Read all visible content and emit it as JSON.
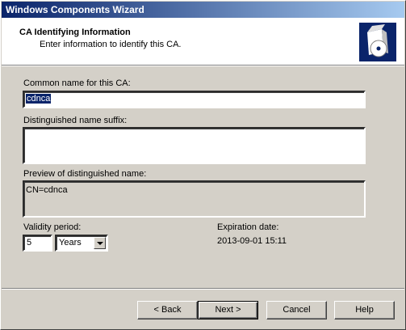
{
  "window": {
    "title": "Windows Components Wizard"
  },
  "header": {
    "title": "CA Identifying Information",
    "subtitle": "Enter information to identify this CA."
  },
  "form": {
    "common_name_label": "Common name for this CA:",
    "common_name_value": "cdnca",
    "dn_suffix_label": "Distinguished name suffix:",
    "dn_suffix_value": "",
    "preview_label": "Preview of distinguished name:",
    "preview_value": "CN=cdnca",
    "validity_label": "Validity period:",
    "validity_value": "5",
    "validity_unit": "Years",
    "expiration_label": "Expiration date:",
    "expiration_value": "2013-09-01 15:11"
  },
  "buttons": {
    "back": "< Back",
    "next": "Next >",
    "cancel": "Cancel",
    "help": "Help"
  }
}
